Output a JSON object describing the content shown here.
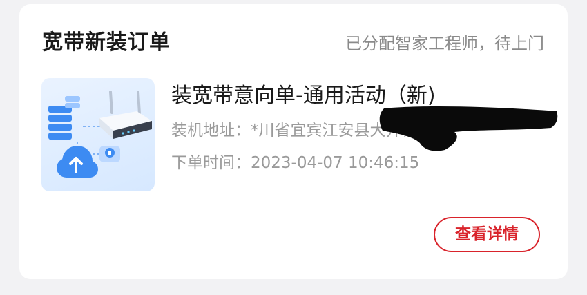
{
  "card": {
    "title": "宽带新装订单",
    "status": "已分配智家工程师，待上门"
  },
  "order": {
    "name": "装宽带意向单-通用活动（新)",
    "address_label": "装机地址：",
    "address_value": "*川省宜宾江安县大井镇",
    "time_label": "下单时间：",
    "time_value": "2023-04-07 10:46:15",
    "thumbnail_icon": "broadband-router-illustration"
  },
  "actions": {
    "detail_label": "查看详情"
  },
  "colors": {
    "accent": "#d9232b",
    "title_text": "#1a1a1a",
    "secondary_text": "#9a9a9a",
    "status_text": "#8a8a8a",
    "card_bg": "#ffffff",
    "page_bg": "#f2f2f4",
    "thumbnail_blue": "#3d8bf2"
  }
}
